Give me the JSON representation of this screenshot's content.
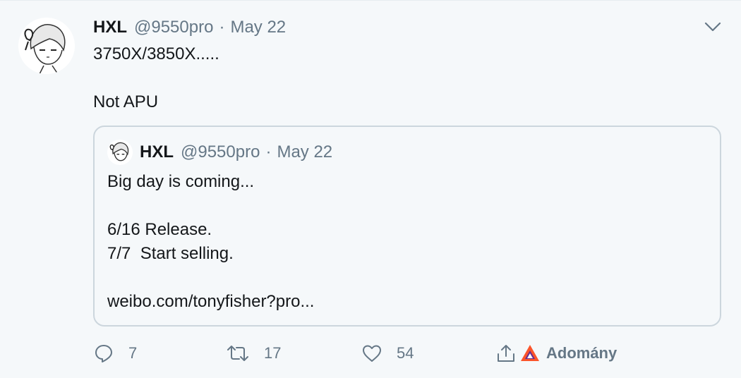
{
  "tweet": {
    "author_name": "HXL",
    "author_handle": "@9550pro",
    "separator": "·",
    "date": "May 22",
    "text_line1": "3750X/3850X.....",
    "text_line2": "Not APU"
  },
  "quoted": {
    "author_name": "HXL",
    "author_handle": "@9550pro",
    "separator": "·",
    "date": "May 22",
    "line1": "Big day is coming...",
    "line2": "6/16 Release.",
    "line3": "7/7  Start selling.",
    "line4": "weibo.com/tonyfisher?pro..."
  },
  "actions": {
    "reply_count": "7",
    "retweet_count": "17",
    "like_count": "54",
    "brave_label": "Adomány"
  },
  "colors": {
    "background": "#f5f8fa",
    "secondary_text": "#657786",
    "border": "#ccd6dd",
    "brave_orange": "#fb542b",
    "brave_purple": "#662d91"
  }
}
